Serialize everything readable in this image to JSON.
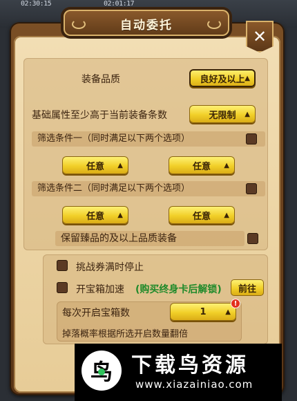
{
  "status_bar": {
    "left_time": "02:30:15",
    "mid_time": "02:01:17"
  },
  "dialog": {
    "title": "自动委托",
    "close_label": "✕"
  },
  "equipment": {
    "quality_label": "装备品质",
    "quality_value": "良好及以上",
    "base_attr_label": "基础属性至少高于当前装备条数",
    "base_attr_value": "无限制"
  },
  "filter1": {
    "label": "筛选条件一（同时满足以下两个选项）",
    "option_a": "任意",
    "option_b": "任意",
    "checked": false
  },
  "filter2": {
    "label": "筛选条件二（同时满足以下两个选项）",
    "option_a": "任意",
    "option_b": "任意",
    "checked": false
  },
  "keep_rare": {
    "label": "保留臻品的及以上品质装备",
    "checked": false
  },
  "challenge": {
    "label": "挑战券满时停止",
    "checked": false
  },
  "chest_speed": {
    "label": "开宝箱加速",
    "unlock_hint": "(购买终身卡后解锁)",
    "goto_label": "前往",
    "checked": false
  },
  "chest_count": {
    "label": "每次开启宝箱数",
    "value": "1",
    "alert_icon": "!",
    "note": "掉落概率根据所选开启数量翻倍"
  },
  "watermark": {
    "title": "下载鸟资源",
    "url": "www.xiazainiao.com",
    "logo_glyph": "鸟"
  },
  "colors": {
    "panel_bg": "#f2deb4",
    "frame": "#6b4220",
    "dropdown": "#f1cf28",
    "checkbox": "#5b3a24",
    "accent_green": "#1f8a2a",
    "alert_red": "#e3301c"
  }
}
